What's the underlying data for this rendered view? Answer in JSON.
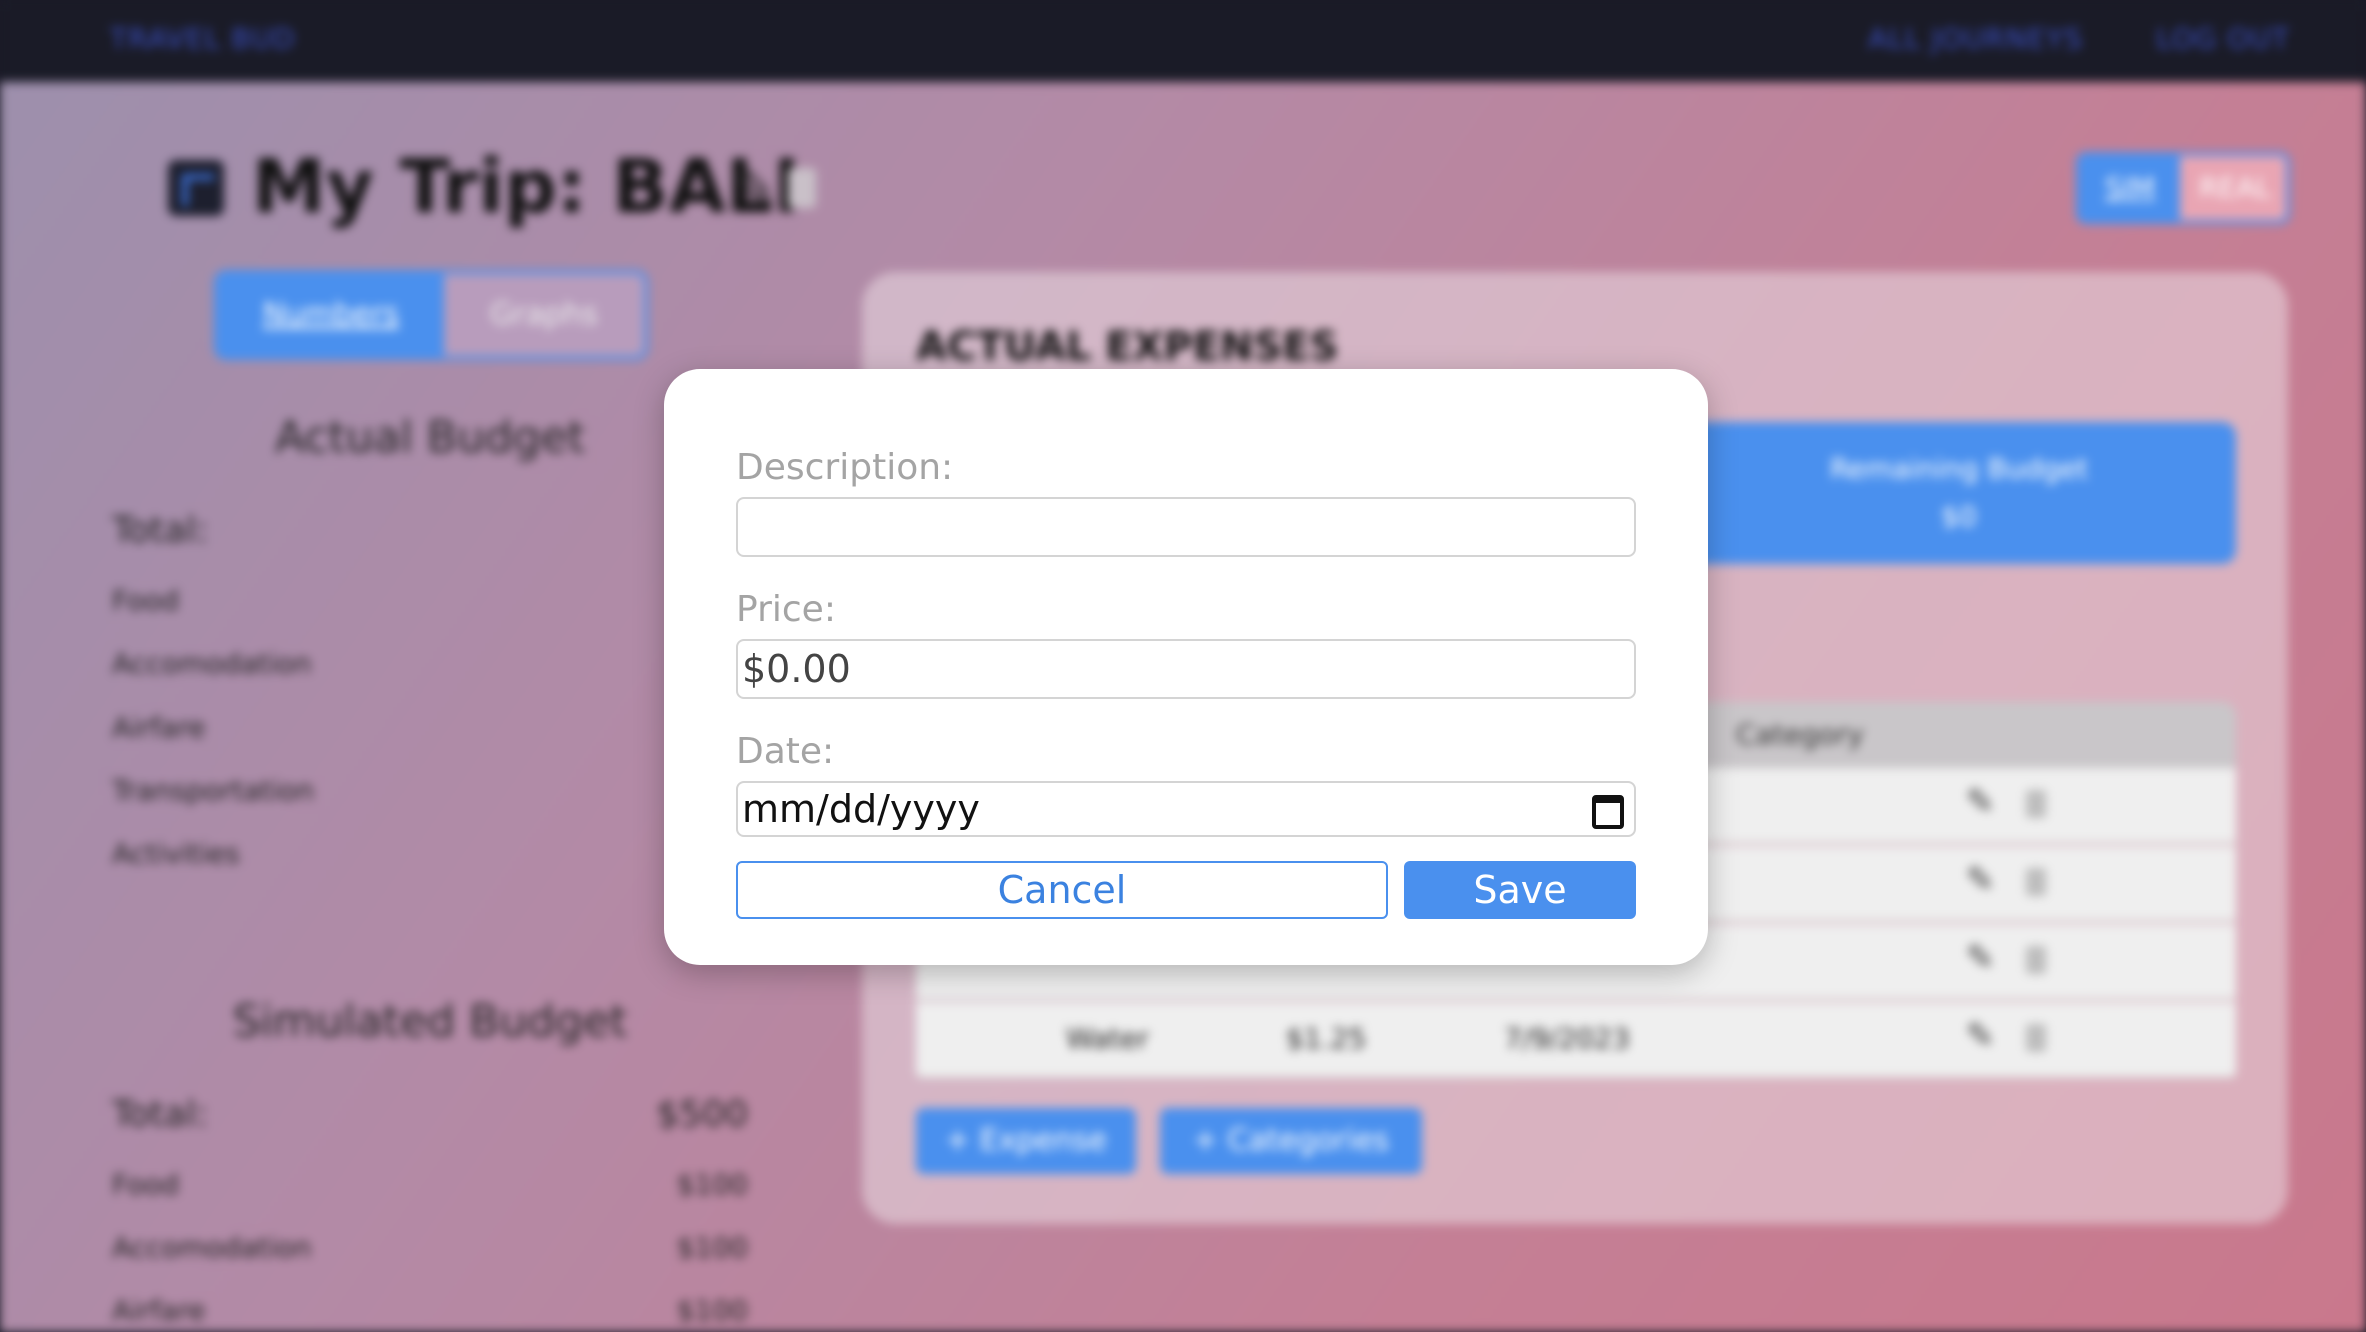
{
  "navbar": {
    "brand": "TRAVEL BUD",
    "links": [
      "ALL JOURNEYS",
      "LOG OUT"
    ]
  },
  "trip": {
    "title": "My Trip: BALI"
  },
  "mode_toggle": {
    "sim": "SIM",
    "real": "REAL"
  },
  "view_toggle": {
    "numbers": "Numbers",
    "graphs": "Graphs"
  },
  "actual_budget": {
    "heading": "Actual Budget",
    "total_label": "Total:",
    "total_value": "$",
    "categories": [
      "Food",
      "Accomodation",
      "Airfare",
      "Transportation",
      "Activities"
    ]
  },
  "simulated_budget": {
    "heading": "Simulated Budget",
    "total_label": "Total:",
    "total_value": "$500",
    "items": [
      {
        "label": "Food",
        "value": "$100"
      },
      {
        "label": "Accomodation",
        "value": "$100"
      },
      {
        "label": "Airfare",
        "value": "$100"
      }
    ]
  },
  "expenses": {
    "title": "ACTUAL EXPENSES",
    "remaining_label": "Remaining Budget",
    "remaining_value": "$0",
    "table_header_category": "Category",
    "last_row": {
      "description": "Water",
      "price": "$1.25",
      "date": "7/9/2023"
    },
    "add_expense": "+ Expense",
    "add_categories": "+ Categories"
  },
  "modal": {
    "description_label": "Description:",
    "description_value": "",
    "price_label": "Price:",
    "price_value": "$0.00",
    "date_label": "Date:",
    "date_placeholder": "mm/dd/yyyy",
    "cancel": "Cancel",
    "save": "Save"
  },
  "colors": {
    "accent": "#4a90ee",
    "navbar_bg": "#1a1b27",
    "modal_bg": "#ffffff"
  }
}
